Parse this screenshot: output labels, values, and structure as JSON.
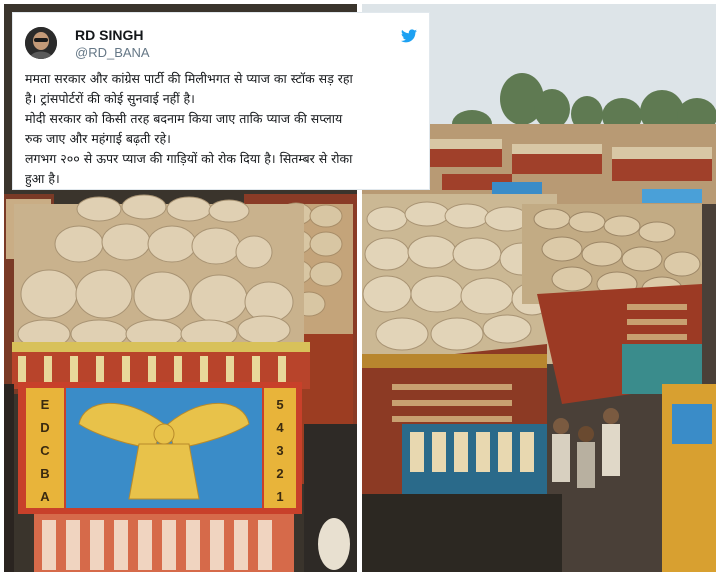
{
  "tweet": {
    "author_name": "RD SINGH",
    "author_handle": "@RD_BANA",
    "icons": {
      "avatar": "avatar-photo",
      "brand": "twitter-bird-icon"
    },
    "accent_color": "#1da1f2",
    "lines": [
      "ममता सरकार और कांग्रेस पार्टी की मिलीभगत  से प्याज का स्टॉक सड़ रहा",
      "है। ट्रांसपोर्टरों की कोई सुनवाई नहीं है।",
      "मोदी सरकार को किसी तरह बदनाम किया जाए ताकि प्याज की सप्लाय",
      "रुक जाए और महंगाई बढ़ती रहे।",
      "लगभग २०० से ऊपर प्याज की गाड़ियों को रोक दिया है। सितम्बर से रोका",
      "हुआ है।"
    ]
  },
  "photo_left": {
    "truck_letters": [
      "E",
      "D",
      "C",
      "B",
      "A"
    ],
    "truck_numbers": [
      "5",
      "4",
      "3",
      "2",
      "1"
    ]
  },
  "photo_right": {}
}
